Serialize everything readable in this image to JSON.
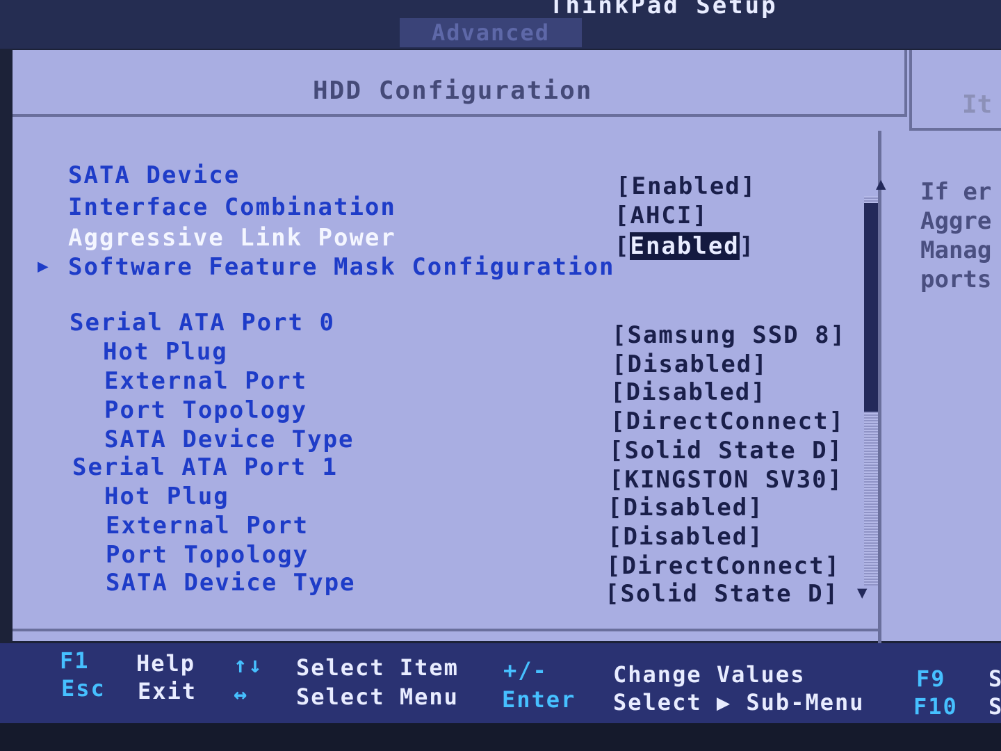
{
  "app": {
    "title": "ThinkPad Setup",
    "active_tab": "Advanced"
  },
  "main": {
    "title": "HDD Configuration"
  },
  "side": {
    "title": "It",
    "help_lines": [
      "If er",
      "Aggre",
      "Manag",
      "ports"
    ]
  },
  "settings": [
    {
      "label": "SATA Device",
      "value": "[Enabled]"
    },
    {
      "label": "Interface Combination",
      "value": "[AHCI]"
    },
    {
      "label": "Aggressive Link Power",
      "value_open": "[",
      "value_highlight": "Enabled",
      "value_close": "]"
    },
    {
      "label": "Software Feature Mask Configuration",
      "submenu_marker": "▶"
    },
    {
      "label": "Serial ATA Port 0",
      "value": "[Samsung SSD 8]"
    },
    {
      "label": "Hot Plug",
      "value": "[Disabled]"
    },
    {
      "label": "External Port",
      "value": "[Disabled]"
    },
    {
      "label": "Port Topology",
      "value": "[DirectConnect]"
    },
    {
      "label": "SATA Device Type",
      "value": "[Solid State D]"
    },
    {
      "label": "Serial ATA Port 1",
      "value": "[KINGSTON SV30]"
    },
    {
      "label": "Hot Plug",
      "value": "[Disabled]"
    },
    {
      "label": "External Port",
      "value": "[Disabled]"
    },
    {
      "label": "Port Topology",
      "value": "[DirectConnect]"
    },
    {
      "label": "SATA Device Type",
      "value": "[Solid State D]"
    }
  ],
  "scrollbar": {
    "up": "▲",
    "down": "▼"
  },
  "footer": {
    "f1_key": "F1",
    "f1_text": "Help",
    "esc_key": "Esc",
    "esc_text": "Exit",
    "updown_key": "↑↓",
    "updown_text": "Select Item",
    "leftright_key": "↔",
    "leftright_text": "Select Menu",
    "plusminus_key": "+/-",
    "plusminus_text": "Change Values",
    "enter_key": "Enter",
    "enter_text": "Select ▶ Sub-Menu",
    "f9_key": "F9",
    "f9_text": "S",
    "f10_key": "F10",
    "f10_text": "S"
  }
}
